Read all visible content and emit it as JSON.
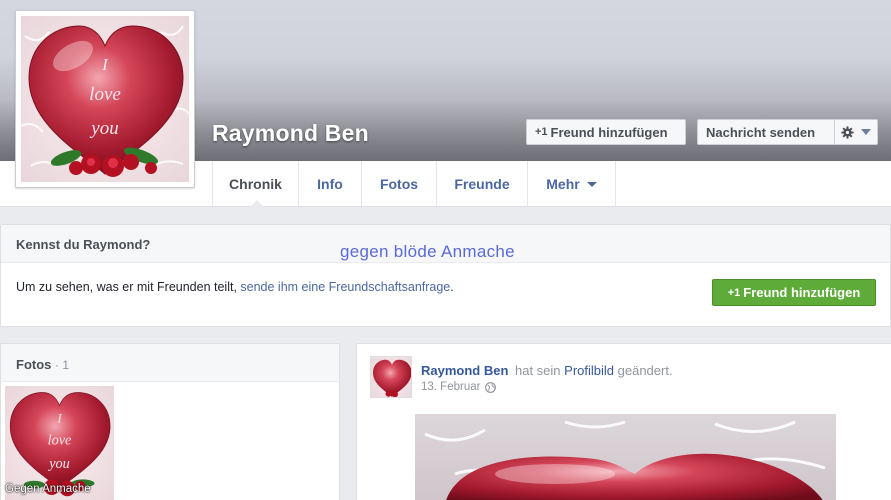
{
  "profile": {
    "name": "Raymond Ben",
    "picture_text": [
      "I",
      "love",
      "you"
    ]
  },
  "actions": {
    "add_friend": "Freund hinzufügen",
    "add_friend_plus": "+1",
    "message": "Nachricht senden",
    "settings_icon": "gear-icon"
  },
  "nav": {
    "tabs": [
      {
        "label": "Chronik",
        "active": true
      },
      {
        "label": "Info"
      },
      {
        "label": "Fotos"
      },
      {
        "label": "Freunde"
      },
      {
        "label": "Mehr"
      }
    ]
  },
  "know": {
    "title": "Kennst du Raymond?",
    "text_prefix": "Um zu sehen, was er mit Freunden teilt, ",
    "link": "sende ihm eine Freundschaftsanfrage",
    "text_suffix": ".",
    "button": "Freund hinzufügen"
  },
  "watermark": "gegen blöde Anmache",
  "photos": {
    "title": "Fotos",
    "count": "· 1"
  },
  "post": {
    "author": "Raymond Ben",
    "action_prefix": "hat sein ",
    "action_link": "Profilbild",
    "action_suffix": " geändert.",
    "date": "13. Februar"
  },
  "footer_watermark": "Gegen Anmache",
  "colors": {
    "link": "#4b67a1",
    "green_button": "#5fab3a",
    "watermark": "#5a6ad6",
    "heart": "#c0283a"
  }
}
